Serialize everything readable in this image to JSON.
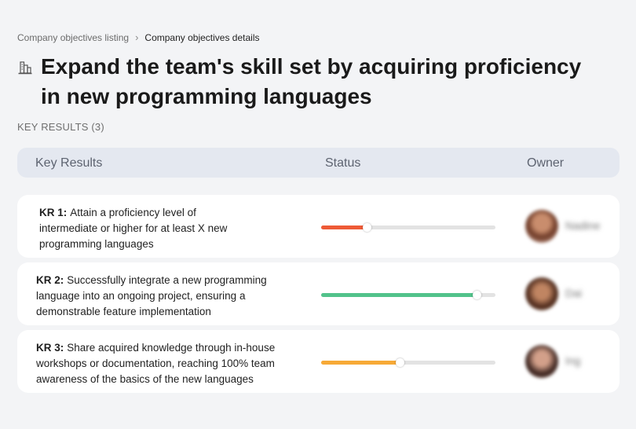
{
  "breadcrumb": {
    "parent": "Company objectives listing",
    "separator": "›",
    "current": "Company objectives details"
  },
  "objective": {
    "icon": "building-chart-icon",
    "title": "Expand the team's skill set by acquiring proficiency in new programming languages"
  },
  "key_results_heading": "KEY RESULTS (3)",
  "table": {
    "headers": {
      "key_results": "Key Results",
      "status": "Status",
      "owner": "Owner"
    },
    "rows": [
      {
        "label": "KR 1:",
        "text": "Attain a proficiency level of intermediate or higher for at least X new programming languages",
        "progress": 0.26,
        "color": "#ee5a36",
        "owner": "Nadine"
      },
      {
        "label": "KR 2:",
        "text": "Successfully integrate a new programming language into an ongoing project, ensuring a demonstrable feature implementation",
        "progress": 0.89,
        "color": "#52c28b",
        "owner": "Dai"
      },
      {
        "label": "KR 3:",
        "text": "Share acquired knowledge through in-house workshops or documentation, reaching 100% team awareness of the basics of the new languages",
        "progress": 0.45,
        "color": "#f7a936",
        "owner": "Ing"
      }
    ]
  }
}
